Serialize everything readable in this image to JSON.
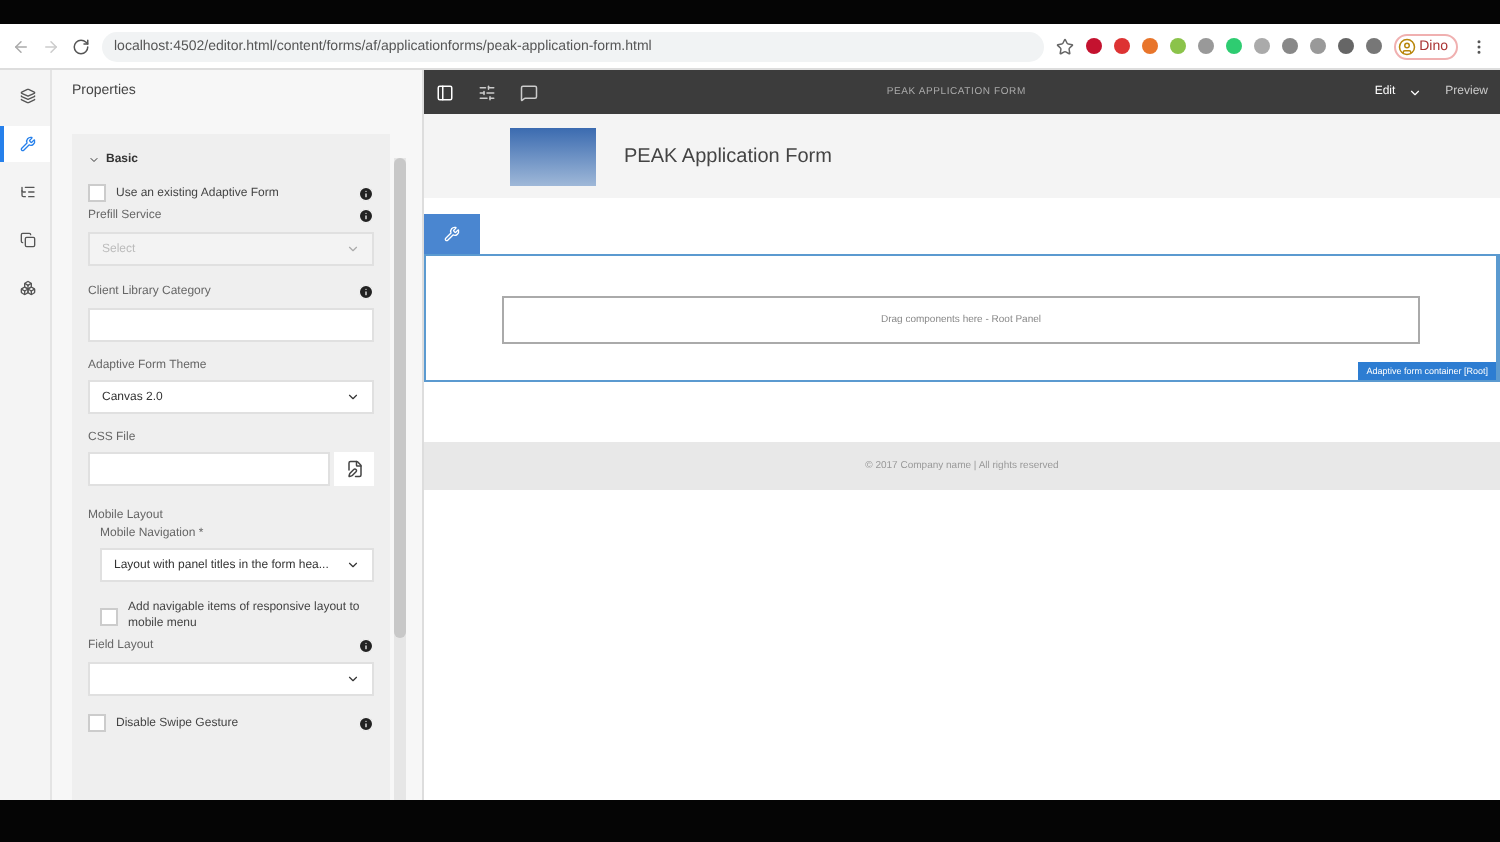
{
  "browser": {
    "url": "localhost:4502/editor.html/content/forms/af/applicationforms/peak-application-form.html",
    "profile": "Dino"
  },
  "sidebar": {
    "title": "Properties",
    "rail": [
      {
        "kind": "layers",
        "selected": false
      },
      {
        "kind": "properties",
        "selected": true
      },
      {
        "kind": "tree",
        "selected": false
      },
      {
        "kind": "assets",
        "selected": false
      },
      {
        "kind": "components",
        "selected": false
      }
    ],
    "section": {
      "title": "Basic",
      "expanded": true
    },
    "fields": [
      {
        "kind": "checkbox",
        "label": "Use an existing Adaptive Form",
        "checked": false,
        "info": true
      },
      {
        "kind": "select",
        "label": "Prefill Service",
        "placeholder": "Select",
        "disabled": true,
        "info": true
      },
      {
        "kind": "text",
        "label": "Client Library Category",
        "info": true
      },
      {
        "kind": "select",
        "label": "Adaptive Form Theme",
        "value": "Canvas 2.0",
        "disabled": false,
        "info": false
      },
      {
        "kind": "file",
        "label": "CSS File",
        "info": false
      },
      {
        "kind": "heading",
        "label": "Mobile Layout"
      },
      {
        "kind": "select",
        "label": "Mobile Navigation *",
        "value": "Layout with panel titles in the form hea...",
        "disabled": false,
        "info": false,
        "indent": true
      },
      {
        "kind": "checkbox",
        "label": "Add navigable items of responsive layout to mobile menu",
        "checked": false,
        "info": false,
        "indent": true
      },
      {
        "kind": "select",
        "label": "Field Layout",
        "disabled": false,
        "info": true
      },
      {
        "kind": "checkbox",
        "label": "Disable Swipe Gesture",
        "checked": false,
        "info": true
      }
    ]
  },
  "toolbar": {
    "title": "PEAK APPLICATION FORM",
    "mode": "Edit",
    "preview": "Preview"
  },
  "form": {
    "title": "PEAK Application Form",
    "drop_zone": "Drag components here - Root Panel",
    "container_label": "Adaptive form container [Root]",
    "footer": "© 2017 Company name | All rights reserved"
  }
}
